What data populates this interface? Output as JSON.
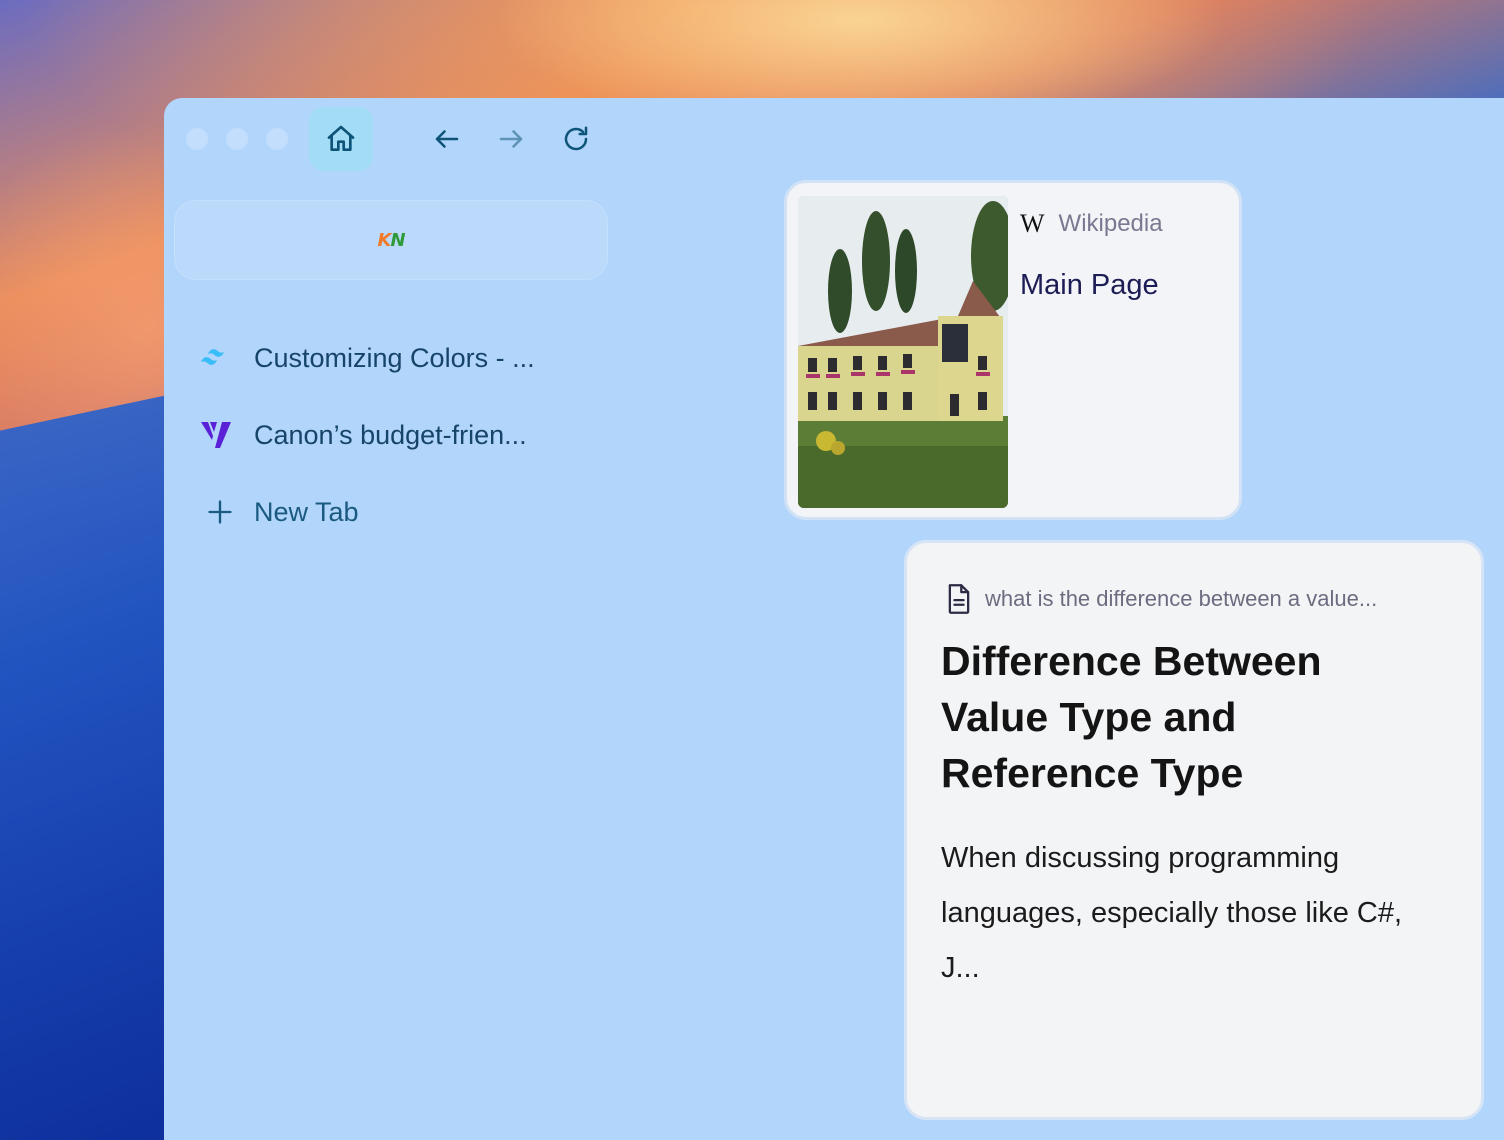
{
  "toolbar": {
    "home_icon": "home-icon",
    "back_icon": "arrow-left-icon",
    "forward_icon": "arrow-right-icon",
    "reload_icon": "reload-icon"
  },
  "address_bar": {
    "site_logo_text": "KN",
    "site_logo_colors": [
      "#f07a2a",
      "#2f9a3a"
    ]
  },
  "tabs": [
    {
      "label": "Customizing Colors - ...",
      "icon": "tailwind-icon"
    },
    {
      "label": "Canon’s budget-frien...",
      "icon": "verge-icon"
    }
  ],
  "new_tab": {
    "label": "New Tab",
    "icon": "plus-icon"
  },
  "wiki_card": {
    "source": "Wikipedia",
    "source_mark": "W",
    "title": "Main Page",
    "image_alt": "building-photo"
  },
  "doc_card": {
    "query": "what is the difference between a value...",
    "title": "Difference Between Value Type and Reference Type",
    "body": "When discussing programming languages, especially those like  C#, J..."
  },
  "colors": {
    "window_bg": "#b2d5fb",
    "card_bg": "#f2f4f7",
    "home_btn_bg": "#a3dcf5",
    "icon_color": "#0d5478"
  }
}
